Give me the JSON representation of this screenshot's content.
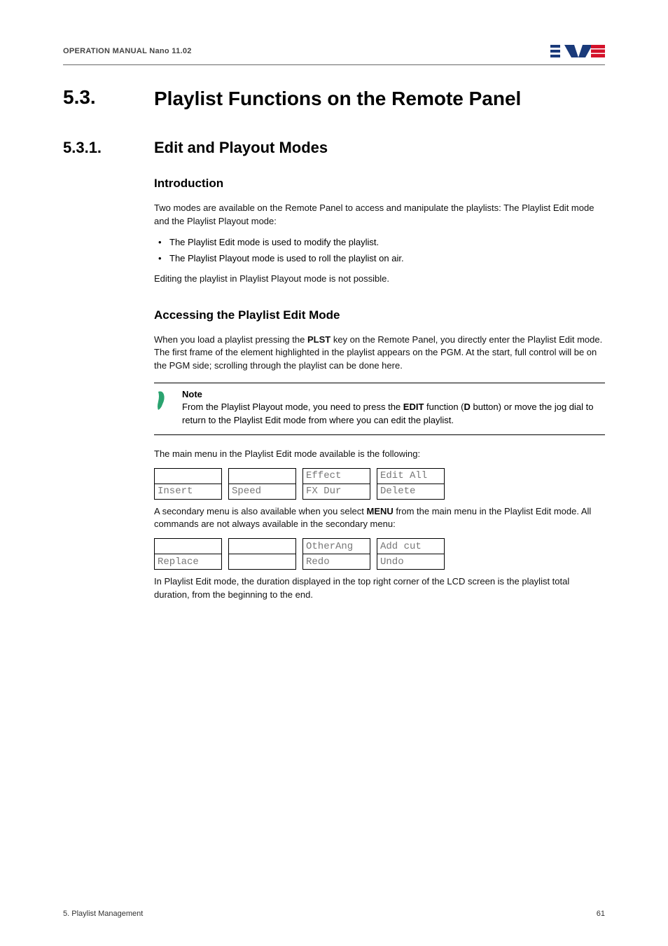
{
  "header": {
    "left": "OPERATION MANUAL Nano 11.02"
  },
  "h2": {
    "num": "5.3.",
    "title": "Playlist Functions on the Remote Panel"
  },
  "h3": {
    "num": "5.3.1.",
    "title": "Edit and Playout Modes"
  },
  "section_intro": {
    "heading": "Introduction",
    "p1": "Two modes are available on the Remote Panel to access and manipulate the playlists: The Playlist Edit mode and the Playlist Playout mode:",
    "b1": "The Playlist Edit mode is used to modify the playlist.",
    "b2": "The Playlist Playout mode is used to roll the playlist on air.",
    "p2": "Editing the playlist in Playlist Playout mode is not possible."
  },
  "section_access": {
    "heading": "Accessing the Playlist Edit Mode",
    "p1_pre": "When you load a playlist pressing the ",
    "p1_bold1": "PLST",
    "p1_post": " key on the Remote Panel, you directly enter the Playlist Edit mode. The first frame of the element highlighted in the playlist appears on the PGM. At the start, full control will be on the PGM side; scrolling through the playlist can be done here.",
    "note_title": "Note",
    "note_pre": "From the Playlist Playout mode, you need to press the ",
    "note_b1": "EDIT",
    "note_mid1": " function (",
    "note_b2": "D",
    "note_mid2": " button) or move the jog dial to return to the Playlist Edit mode from where you can edit the playlist.",
    "p2": "The main menu in the Playlist Edit mode available is the following:",
    "table1": {
      "r0c0": "",
      "r0c1": "",
      "r0c2": "Effect",
      "r0c3": "Edit All",
      "r1c0": "Insert",
      "r1c1": "Speed",
      "r1c2": "FX Dur",
      "r1c3": "Delete"
    },
    "p3_pre": "A secondary menu is also available when you select ",
    "p3_bold": "MENU",
    "p3_post": " from the main menu in the Playlist Edit mode. All commands are not always available in the secondary menu:",
    "table2": {
      "r0c0": "",
      "r0c1": "",
      "r0c2": "OtherAng",
      "r0c3": "Add cut",
      "r1c0": "Replace",
      "r1c1": "",
      "r1c2": "Redo",
      "r1c3": "Undo"
    },
    "p4": "In Playlist Edit mode, the duration displayed in the top right corner of the LCD screen is the playlist total duration, from the beginning to the end."
  },
  "footer": {
    "left": "5. Playlist Management",
    "right": "61"
  }
}
